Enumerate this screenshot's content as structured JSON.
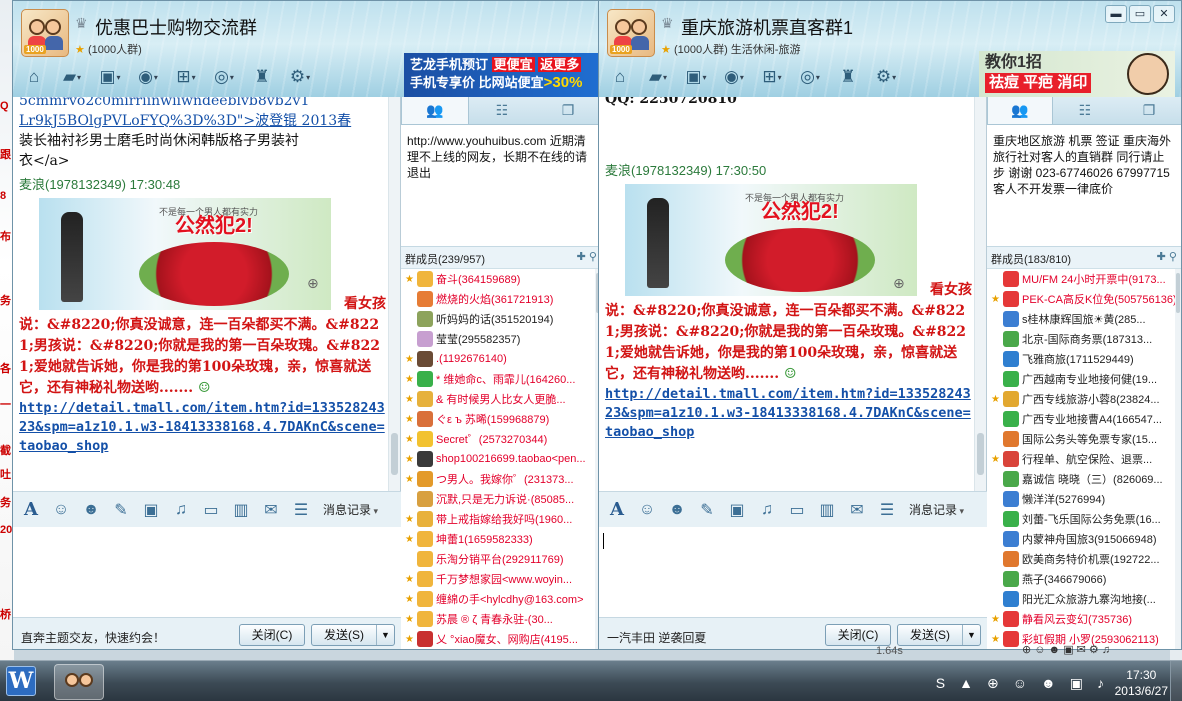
{
  "window1": {
    "title": "优惠巴士购物交流群",
    "subtitle": "(1000人群)",
    "ad": {
      "line1a": "艺龙手机预订",
      "line1b": "更便宜",
      "line1c": "返更多",
      "line2a": "手机专享价 比网站便宜",
      "line2b": ">30%"
    },
    "chat": {
      "code_line1": "Lr9kJ5BOlgPVLoFYQ%3D%3D\">波登锟 2013春",
      "code_line2": "装长袖衬衫男士磨毛时尚休闲韩版格子男装衬",
      "code_line3": "衣</a>",
      "sender": "麦浪(1978132349)  17:30:48",
      "ad_slogan": "公然犯2!",
      "ad_small": "不是每一个男人都有实力",
      "msg_first": "看女孩",
      "msg_rest": "说：&#8220;你真没诚意，连一百朵都买不满。&#8221;男孩说：&#8220;你就是我的第一百朵玫瑰。&#8221;爱她就告诉她，你是我的第100朵玫瑰，亲，惊喜就送它，还有神秘礼物送哟.......",
      "url": "http://detail.tmall.com/item.htm?id=13352824323&spm=a1z10.1.w3-18413338168.4.7DAKnC&scene=taobao_shop"
    },
    "toolbar_record": "消息记录",
    "hint": "直奔主题交友，快速约会！",
    "close_label": "关闭(C)",
    "send_label": "发送(S)",
    "notice": "http://www.youhuibus.com   近期清理不上线的网友，长期不在线的请退出",
    "members_header": "群成员(239/957)",
    "members": [
      {
        "name": "奋斗(364159689)",
        "color": "#e3002b",
        "badge": "★",
        "av": "#f0b53c"
      },
      {
        "name": "燃烧的火焰(361721913)",
        "color": "#e3002b",
        "badge": "",
        "av": "#e67c35"
      },
      {
        "name": "听妈妈的话(351520194)",
        "color": "#222222",
        "badge": "",
        "av": "#8da35c"
      },
      {
        "name": "莹莹(295582357)",
        "color": "#222222",
        "badge": "",
        "av": "#c79fd0"
      },
      {
        "name": "            .(1192676140)",
        "color": "#e3002b",
        "badge": "★",
        "av": "#6a4b35"
      },
      {
        "name": "* 维她命c、雨霏儿(164260...",
        "color": "#e3002b",
        "badge": "★",
        "av": "#39b04a"
      },
      {
        "name": "& 有时候男人比女人更脆...",
        "color": "#e3002b",
        "badge": "★",
        "av": "#e6b13c"
      },
      {
        "name": "ぐε ъ 苏晞(159968879)",
        "color": "#e3002b",
        "badge": "★",
        "av": "#d9703a"
      },
      {
        "name": "Secret゜(2573270344)",
        "color": "#e3002b",
        "badge": "★",
        "av": "#f2c230"
      },
      {
        "name": "shop100216699.taobao<pen...",
        "color": "#e3002b",
        "badge": "★",
        "av": "#3a3a3a"
      },
      {
        "name": "つ男人。我嫁你゜(231373...",
        "color": "#e3002b",
        "badge": "★",
        "av": "#e39a2a"
      },
      {
        "name": "沉默,只是无力诉说·(85085...",
        "color": "#e3002b",
        "badge": "",
        "av": "#d8a040"
      },
      {
        "name": "带上戒指嫁给我好吗(1960...",
        "color": "#e3002b",
        "badge": "★",
        "av": "#e8b13b"
      },
      {
        "name": "坤蕾1(1659582333)",
        "color": "#e3002b",
        "badge": "★",
        "av": "#f0b53c"
      },
      {
        "name": "乐淘分销平台(292911769)",
        "color": "#e3002b",
        "badge": "",
        "av": "#f0b53c"
      },
      {
        "name": "千万梦想家园<www.woyin...",
        "color": "#e3002b",
        "badge": "★",
        "av": "#f0b53c"
      },
      {
        "name": "缠綿の手<hylcdhy@163.com>",
        "color": "#e3002b",
        "badge": "★",
        "av": "#f0b53c"
      },
      {
        "name": "苏晨 ®     ζ 青春永驻-(30...",
        "color": "#e3002b",
        "badge": "★",
        "av": "#f0b53c"
      },
      {
        "name": "乂 °xiao魔女、网购店(4195...",
        "color": "#e3002b",
        "badge": "★",
        "av": "#c83030"
      }
    ]
  },
  "window2": {
    "title": "重庆旅游机票直客群1",
    "subtitle": "(1000人群) 生活休闲-旅游",
    "ad": {
      "line1": "教你1招",
      "line2": "祛痘 平疤 消印"
    },
    "chat": {
      "top_line": "QQ: 2250720810",
      "sender": "麦浪(1978132349)  17:30:50",
      "ad_slogan": "公然犯2!",
      "ad_small": "不是每一个男人都有实力",
      "msg_first": "看女孩",
      "msg_rest": "说：&#8220;你真没诚意，连一百朵都买不满。&#8221;男孩说：&#8220;你就是我的第一百朵玫瑰。&#8221;爱她就告诉她，你是我的第100朵玫瑰，亲，惊喜就送它，还有神秘礼物送哟.......",
      "url": "http://detail.tmall.com/item.htm?id=13352824323&spm=a1z10.1.w3-18413338168.4.7DAKnC&scene=taobao_shop"
    },
    "toolbar_record": "消息记录",
    "hint": "一汽丰田 逆袭回夏",
    "close_label": "关闭(C)",
    "send_label": "发送(S)",
    "notice": "重庆地区旅游 机票 签证 重庆海外旅行社对客人的直销群 同行请止步 谢谢 023-67746026 67997715客人不开发票一律底价",
    "members_header": "群成员(183/810)",
    "members": [
      {
        "name": "MU/FM 24小时开票中(9173...",
        "color": "#e3002b",
        "badge": "",
        "av": "#e53838"
      },
      {
        "name": "PEK-CA高反K位免(505756136)",
        "color": "#e3002b",
        "badge": "★",
        "av": "#e53838"
      },
      {
        "name": "  s桂林康辉国旅☀黄(285...",
        "color": "#222222",
        "badge": "",
        "av": "#3c7ed2"
      },
      {
        "name": "北京-国际商务票(187313...",
        "color": "#222222",
        "badge": "",
        "av": "#4aa84a"
      },
      {
        "name": "飞雅商旅(1711529449)",
        "color": "#222222",
        "badge": "",
        "av": "#2f7fd0"
      },
      {
        "name": "广西越南专业地接何健(19...",
        "color": "#222222",
        "badge": "",
        "av": "#39b04a"
      },
      {
        "name": "广西专线旅游小蓉8(23824...",
        "color": "#222222",
        "badge": "★",
        "av": "#e2a830"
      },
      {
        "name": "广西专业地接曹A4(166547...",
        "color": "#222222",
        "badge": "",
        "av": "#39b04a"
      },
      {
        "name": "国际公务头等免票专家(15...",
        "color": "#222222",
        "badge": "",
        "av": "#e0782e"
      },
      {
        "name": "行程单、航空保险、退票...",
        "color": "#222222",
        "badge": "★",
        "av": "#d9443a"
      },
      {
        "name": "嘉诚信 晓晓（三）(826069...",
        "color": "#222222",
        "badge": "",
        "av": "#4aa84a"
      },
      {
        "name": "懒洋洋(5276994)",
        "color": "#222222",
        "badge": "",
        "av": "#3c7ed2"
      },
      {
        "name": "刘蕾-飞乐国际公务免票(16...",
        "color": "#222222",
        "badge": "",
        "av": "#39b04a"
      },
      {
        "name": "内蒙神舟国旅3(915066948)",
        "color": "#222222",
        "badge": "",
        "av": "#3c7ed2"
      },
      {
        "name": "欧美商务特价机票(192722...",
        "color": "#222222",
        "badge": "",
        "av": "#e0782e"
      },
      {
        "name": "燕子(346679066)",
        "color": "#222222",
        "badge": "",
        "av": "#4aa84a"
      },
      {
        "name": "阳光汇众旅游九寨沟地接(...",
        "color": "#222222",
        "badge": "",
        "av": "#2f7fd0"
      },
      {
        "name": "静看风云变幻(735736)",
        "color": "#e3002b",
        "badge": "★",
        "av": "#e53838"
      },
      {
        "name": "彩虹假期 小罗(2593062113)",
        "color": "#e3002b",
        "badge": "★",
        "av": "#e53838"
      }
    ]
  },
  "taskbar": {
    "start_label": "W",
    "time": "17:30",
    "date": "2013/6/27",
    "speed": "1.64s"
  },
  "bg_left": [
    "Q",
    "跟",
    "8",
    "布",
    "务",
    "各",
    "一",
    "截",
    "吐",
    "务",
    "20",
    "桥"
  ]
}
